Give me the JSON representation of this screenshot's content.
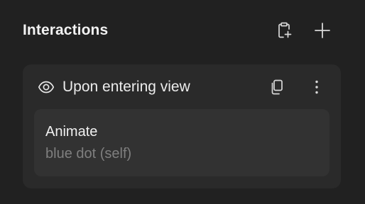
{
  "panel": {
    "title": "Interactions",
    "header_icons": [
      "clipboard-add-icon",
      "plus-icon"
    ]
  },
  "interaction": {
    "trigger_icon": "eye-icon",
    "trigger_label": "Upon entering view",
    "card_icons": [
      "copy-icon",
      "more-vertical-icon"
    ],
    "action": {
      "name": "Animate",
      "target": "blue dot (self)"
    }
  },
  "colors": {
    "background": "#212121",
    "card": "#2a2a2a",
    "action_row": "#323232",
    "text_primary": "#f0f0f0",
    "text_secondary": "#7f7f7f"
  }
}
